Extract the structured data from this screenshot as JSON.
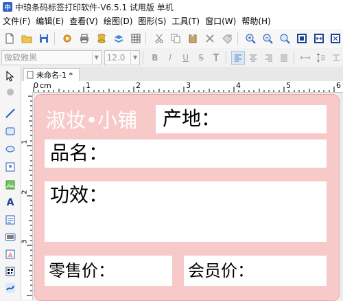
{
  "window": {
    "title": "中琅条码标签打印软件-V6.5.1 试用版 单机"
  },
  "menu": [
    "文件(F)",
    "编辑(E)",
    "查看(V)",
    "绘图(D)",
    "图形(S)",
    "工具(T)",
    "窗口(W)",
    "帮助(H)"
  ],
  "format_bar": {
    "font_name": "微软雅黑",
    "font_size": "12.0",
    "bold": "B",
    "italic": "I",
    "underline": "U",
    "strike": "S"
  },
  "document": {
    "tab_label": "未命名-1 *"
  },
  "ruler": {
    "h_unit": "cm",
    "h_ticks": [
      "0",
      "1",
      "2",
      "3",
      "4",
      "5",
      "6"
    ],
    "v_ticks": [
      "1",
      "2",
      "3"
    ]
  },
  "label_design": {
    "brand": "淑妆•小铺",
    "origin": "产地：",
    "product_name": "品名：",
    "effect": "功效：",
    "retail_price": "零售价：",
    "member_price": "会员价：",
    "colors": {
      "background": "#f8c9c9",
      "field": "#ffffff",
      "brand_text": "#ffffff"
    }
  }
}
